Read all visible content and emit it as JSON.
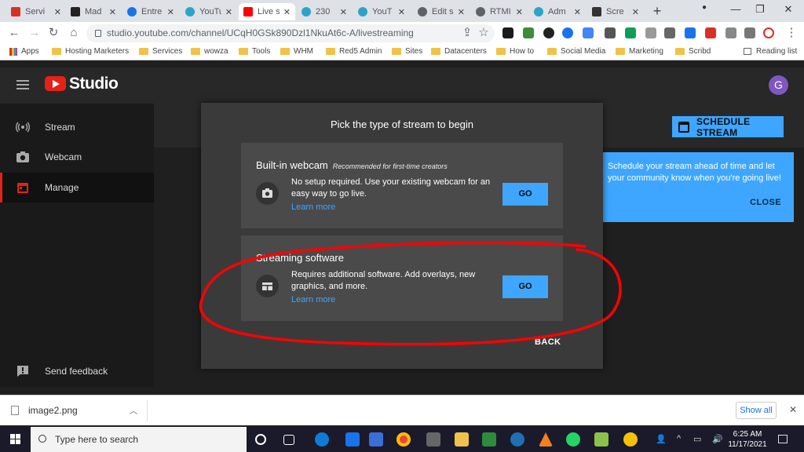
{
  "browser": {
    "tabs": [
      {
        "title": "Servi",
        "favicon_color": "#d93025"
      },
      {
        "title": "Mad",
        "favicon_color": "#222222"
      },
      {
        "title": "Entre",
        "favicon_color": "#1a73e8"
      },
      {
        "title": "YouTu",
        "favicon_color": "#2aa5c8"
      },
      {
        "title": "Live s",
        "favicon_color": "#ff0000"
      },
      {
        "title": "230",
        "favicon_color": "#2aa5c8"
      },
      {
        "title": "YouT",
        "favicon_color": "#2aa5c8"
      },
      {
        "title": "Edit s",
        "favicon_color": "#5f6368"
      },
      {
        "title": "RTMI",
        "favicon_color": "#5f6368"
      },
      {
        "title": "Adm",
        "favicon_color": "#2aa5c8"
      },
      {
        "title": "Scre",
        "favicon_color": "#333333"
      }
    ],
    "active_tab_index": 4,
    "url": "studio.youtube.com/channel/UCqH0GSk890Dzl1NkuAt6c-A/livestreaming",
    "bookmarks": [
      "Apps",
      "Hosting Marketers",
      "Services",
      "wowza",
      "Tools",
      "WHM",
      "Red5 Admin",
      "Sites",
      "Datacenters",
      "How to",
      "Social Media",
      "Marketing",
      "Scribd"
    ],
    "reading_list": "Reading list"
  },
  "studio": {
    "logo_text": "Studio",
    "avatar_letter": "G",
    "sidebar": [
      {
        "label": "Stream",
        "icon": "broadcast-icon"
      },
      {
        "label": "Webcam",
        "icon": "camera-icon"
      },
      {
        "label": "Manage",
        "icon": "calendar-icon"
      }
    ],
    "feedback_label": "Send feedback",
    "schedule_button": "SCHEDULE STREAM",
    "tooltip": {
      "text": "Schedule your stream ahead of time and let your community know when you're going live!",
      "close": "CLOSE"
    }
  },
  "modal": {
    "title": "Pick the type of stream to begin",
    "options": [
      {
        "title": "Built-in webcam",
        "recommendation": "Recommended for first-time creators",
        "description": "No setup required. Use your existing webcam for an easy way to go live.",
        "link": "Learn more",
        "button": "GO",
        "icon": "camera-icon"
      },
      {
        "title": "Streaming software",
        "recommendation": "",
        "description": "Requires additional software. Add overlays, new graphics, and more.",
        "link": "Learn more",
        "button": "GO",
        "icon": "software-icon"
      }
    ],
    "back_button": "BACK"
  },
  "downloads": {
    "file_name": "image2.png",
    "show_all": "Show all"
  },
  "taskbar": {
    "search_placeholder": "Type here to search",
    "time": "6:25 AM",
    "date": "11/17/2021"
  },
  "colors": {
    "accent": "#3ea6ff",
    "youtube_red": "#e62117",
    "annotation_red": "#ff0000"
  }
}
